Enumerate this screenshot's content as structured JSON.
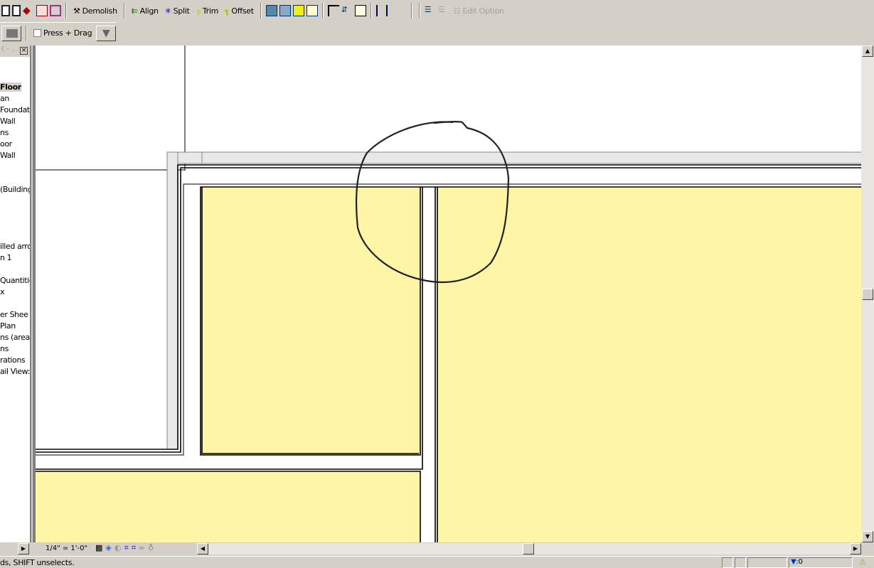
{
  "toolbar": {
    "demolish": "Demolish",
    "align": "Align",
    "split": "Split",
    "trim": "Trim",
    "offset": "Offset",
    "edit_option": "Edit Option",
    "press_drag": "Press + Drag",
    "press_drag_checked": false
  },
  "sidebar": {
    "title": "t - ...",
    "items": [
      "Floor",
      "an",
      "Foundat",
      "Wall",
      "ns",
      "oor",
      "Wall",
      "(Building",
      "illed arro",
      "n 1",
      "Quantitie",
      "x",
      "er Shee",
      "Plan",
      "ns (area c",
      "ns",
      "rations",
      "ail View:"
    ]
  },
  "view": {
    "scale": "1/4\" = 1'-0\""
  },
  "status": {
    "message": "ds, SHIFT unselects.",
    "filter_count": ":0"
  },
  "colors": {
    "room_fill": "#fff5a6",
    "chrome": "#d4d0c8"
  }
}
